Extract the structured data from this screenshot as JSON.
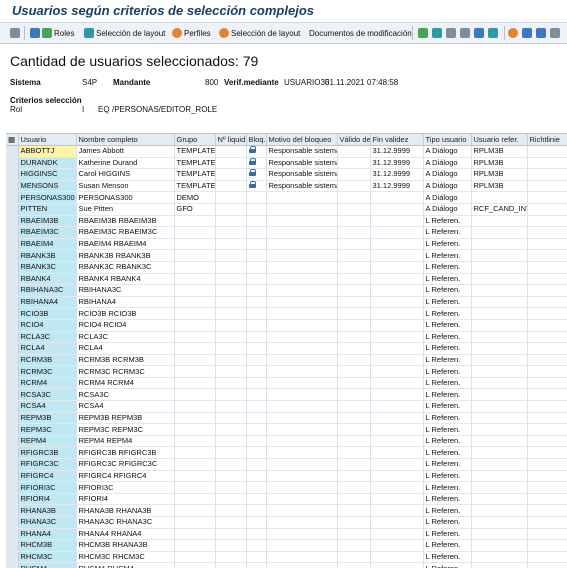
{
  "window": {
    "title": "Usuarios según criterios de selección complejos"
  },
  "toolbar": {
    "roles": "Roles",
    "layout_sel1": "Selección de layout",
    "perfiles": "Perfiles",
    "layout_sel2": "Selección de layout",
    "documentos": "Documentos de modificación"
  },
  "header": {
    "count_title": "Cantidad de usuarios seleccionados: 79",
    "sistema_label": "Sistema",
    "sistema_value": "S4P",
    "mandante_label": "Mandante",
    "mandante_value": "800",
    "verif_label": "Verif.mediante",
    "verif_value": "USUARIO35",
    "date_value": "01.11.2021",
    "time_value": "07:48:58",
    "criteria_label": "Criterios selección",
    "rol_label": "Rol",
    "rol_flag": "I",
    "rol_op": "EQ",
    "rol_value": "/PERSONAS/EDITOR_ROLE"
  },
  "table": {
    "columns": [
      "Usuario",
      "Nombre completo",
      "Grupo",
      "Nº liquid.",
      "Bloq.",
      "Motivo del bloqueo",
      "Válido de",
      "Fin validez",
      "Tipo usuario",
      "Usuario refer.",
      "Richtlinie"
    ],
    "rows": [
      {
        "u": "ABBOTTJ",
        "n": "James Abbott",
        "g": "TEMPLATE",
        "lock": true,
        "m": "Responsable sistema",
        "f": "31.12.9999",
        "t": "A Diálogo",
        "r": "RPLM3B"
      },
      {
        "u": "DURANDK",
        "n": "Katherine Durand",
        "g": "TEMPLATE",
        "lock": true,
        "m": "Responsable sistema",
        "f": "31.12.9999",
        "t": "A Diálogo",
        "r": "RPLM3B"
      },
      {
        "u": "HIGGINSC",
        "n": "Carol HIGGINS",
        "g": "TEMPLATE",
        "lock": true,
        "m": "Responsable sistema",
        "f": "31.12.9999",
        "t": "A Diálogo",
        "r": "RPLM3B"
      },
      {
        "u": "MENSONS",
        "n": "Susan Menson",
        "g": "TEMPLATE",
        "lock": true,
        "m": "Responsable sistema",
        "f": "31.12.9999",
        "t": "A Diálogo",
        "r": "RPLM3B"
      },
      {
        "u": "PERSONAS300",
        "n": "PERSONAS300",
        "g": "DEMO",
        "lock": false,
        "m": "",
        "f": "",
        "t": "A Diálogo",
        "r": ""
      },
      {
        "u": "PITTEN",
        "n": "Sue Pitten",
        "g": "GFO",
        "lock": false,
        "m": "",
        "f": "",
        "t": "A Diálogo",
        "r": "RCF_CAND_INT"
      },
      {
        "u": "RBAEIM3B",
        "n": "RBAEIM3B RBAEIM3B",
        "g": "",
        "lock": false,
        "m": "",
        "f": "",
        "t": "L Referen.",
        "r": ""
      },
      {
        "u": "RBAEIM3C",
        "n": "RBAEIM3C RBAEIM3C",
        "g": "",
        "lock": false,
        "m": "",
        "f": "",
        "t": "L Referen.",
        "r": ""
      },
      {
        "u": "RBAEIM4",
        "n": "RBAEIM4 RBAEIM4",
        "g": "",
        "lock": false,
        "m": "",
        "f": "",
        "t": "L Referen.",
        "r": ""
      },
      {
        "u": "RBANK3B",
        "n": "RBANK3B RBANK3B",
        "g": "",
        "lock": false,
        "m": "",
        "f": "",
        "t": "L Referen.",
        "r": ""
      },
      {
        "u": "RBANK3C",
        "n": "RBANK3C RBANK3C",
        "g": "",
        "lock": false,
        "m": "",
        "f": "",
        "t": "L Referen.",
        "r": ""
      },
      {
        "u": "RBANK4",
        "n": "RBANK4 RBANK4",
        "g": "",
        "lock": false,
        "m": "",
        "f": "",
        "t": "L Referen.",
        "r": ""
      },
      {
        "u": "RBIHANA3C",
        "n": "RBIHANA3C",
        "g": "",
        "lock": false,
        "m": "",
        "f": "",
        "t": "L Referen.",
        "r": ""
      },
      {
        "u": "RBIHANA4",
        "n": "RBIHANA4",
        "g": "",
        "lock": false,
        "m": "",
        "f": "",
        "t": "L Referen.",
        "r": ""
      },
      {
        "u": "RCIO3B",
        "n": "RCIO3B RCIO3B",
        "g": "",
        "lock": false,
        "m": "",
        "f": "",
        "t": "L Referen.",
        "r": ""
      },
      {
        "u": "RCIO4",
        "n": "RCIO4 RCIO4",
        "g": "",
        "lock": false,
        "m": "",
        "f": "",
        "t": "L Referen.",
        "r": ""
      },
      {
        "u": "RCLA3C",
        "n": "RCLA3C",
        "g": "",
        "lock": false,
        "m": "",
        "f": "",
        "t": "L Referen.",
        "r": ""
      },
      {
        "u": "RCLA4",
        "n": "RCLA4",
        "g": "",
        "lock": false,
        "m": "",
        "f": "",
        "t": "L Referen.",
        "r": ""
      },
      {
        "u": "RCRM3B",
        "n": "RCRM3B RCRM3B",
        "g": "",
        "lock": false,
        "m": "",
        "f": "",
        "t": "L Referen.",
        "r": ""
      },
      {
        "u": "RCRM3C",
        "n": "RCRM3C RCRM3C",
        "g": "",
        "lock": false,
        "m": "",
        "f": "",
        "t": "L Referen.",
        "r": ""
      },
      {
        "u": "RCRM4",
        "n": "RCRM4 RCRM4",
        "g": "",
        "lock": false,
        "m": "",
        "f": "",
        "t": "L Referen.",
        "r": ""
      },
      {
        "u": "RCSA3C",
        "n": "RCSA3C",
        "g": "",
        "lock": false,
        "m": "",
        "f": "",
        "t": "L Referen.",
        "r": ""
      },
      {
        "u": "RCSA4",
        "n": "RCSA4",
        "g": "",
        "lock": false,
        "m": "",
        "f": "",
        "t": "L Referen.",
        "r": ""
      },
      {
        "u": "REPM3B",
        "n": "REPM3B REPM3B",
        "g": "",
        "lock": false,
        "m": "",
        "f": "",
        "t": "L Referen.",
        "r": ""
      },
      {
        "u": "REPM3C",
        "n": "REPM3C REPM3C",
        "g": "",
        "lock": false,
        "m": "",
        "f": "",
        "t": "L Referen.",
        "r": ""
      },
      {
        "u": "REPM4",
        "n": "REPM4 REPM4",
        "g": "",
        "lock": false,
        "m": "",
        "f": "",
        "t": "L Referen.",
        "r": ""
      },
      {
        "u": "RFIGRC3B",
        "n": "RFIGRC3B RFIGRC3B",
        "g": "",
        "lock": false,
        "m": "",
        "f": "",
        "t": "L Referen.",
        "r": ""
      },
      {
        "u": "RFIGRC3C",
        "n": "RFIGRC3C RFIGRC3C",
        "g": "",
        "lock": false,
        "m": "",
        "f": "",
        "t": "L Referen.",
        "r": ""
      },
      {
        "u": "RFIGRC4",
        "n": "RFIGRC4 RFIGRC4",
        "g": "",
        "lock": false,
        "m": "",
        "f": "",
        "t": "L Referen.",
        "r": ""
      },
      {
        "u": "RFIORI3C",
        "n": "RFIORI3C",
        "g": "",
        "lock": false,
        "m": "",
        "f": "",
        "t": "L Referen.",
        "r": ""
      },
      {
        "u": "RFIORI4",
        "n": "RFIORI4",
        "g": "",
        "lock": false,
        "m": "",
        "f": "",
        "t": "L Referen.",
        "r": ""
      },
      {
        "u": "RHANA3B",
        "n": "RHANA3B RHANA3B",
        "g": "",
        "lock": false,
        "m": "",
        "f": "",
        "t": "L Referen.",
        "r": ""
      },
      {
        "u": "RHANA3C",
        "n": "RHANA3C RHANA3C",
        "g": "",
        "lock": false,
        "m": "",
        "f": "",
        "t": "L Referen.",
        "r": ""
      },
      {
        "u": "RHANA4",
        "n": "RHANA4 RHANA4",
        "g": "",
        "lock": false,
        "m": "",
        "f": "",
        "t": "L Referen.",
        "r": ""
      },
      {
        "u": "RHCM3B",
        "n": "RHCM3B RHANA3B",
        "g": "",
        "lock": false,
        "m": "",
        "f": "",
        "t": "L Referen.",
        "r": ""
      },
      {
        "u": "RHCM3C",
        "n": "RHCM3C RHCM3C",
        "g": "",
        "lock": false,
        "m": "",
        "f": "",
        "t": "L Referen.",
        "r": ""
      },
      {
        "u": "RHCM4",
        "n": "RHCM4 RHCM4",
        "g": "",
        "lock": false,
        "m": "",
        "f": "",
        "t": "L Referen.",
        "r": ""
      }
    ]
  }
}
